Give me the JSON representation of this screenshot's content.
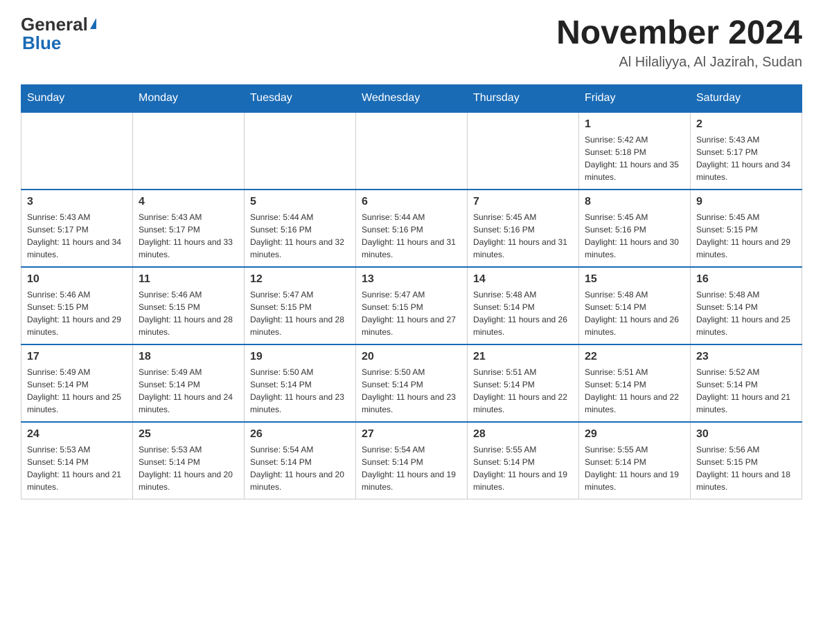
{
  "header": {
    "logo": {
      "general": "General",
      "blue": "Blue"
    },
    "title": "November 2024",
    "subtitle": "Al Hilaliyya, Al Jazirah, Sudan"
  },
  "weekdays": [
    "Sunday",
    "Monday",
    "Tuesday",
    "Wednesday",
    "Thursday",
    "Friday",
    "Saturday"
  ],
  "weeks": [
    [
      {
        "day": "",
        "info": ""
      },
      {
        "day": "",
        "info": ""
      },
      {
        "day": "",
        "info": ""
      },
      {
        "day": "",
        "info": ""
      },
      {
        "day": "",
        "info": ""
      },
      {
        "day": "1",
        "info": "Sunrise: 5:42 AM\nSunset: 5:18 PM\nDaylight: 11 hours and 35 minutes."
      },
      {
        "day": "2",
        "info": "Sunrise: 5:43 AM\nSunset: 5:17 PM\nDaylight: 11 hours and 34 minutes."
      }
    ],
    [
      {
        "day": "3",
        "info": "Sunrise: 5:43 AM\nSunset: 5:17 PM\nDaylight: 11 hours and 34 minutes."
      },
      {
        "day": "4",
        "info": "Sunrise: 5:43 AM\nSunset: 5:17 PM\nDaylight: 11 hours and 33 minutes."
      },
      {
        "day": "5",
        "info": "Sunrise: 5:44 AM\nSunset: 5:16 PM\nDaylight: 11 hours and 32 minutes."
      },
      {
        "day": "6",
        "info": "Sunrise: 5:44 AM\nSunset: 5:16 PM\nDaylight: 11 hours and 31 minutes."
      },
      {
        "day": "7",
        "info": "Sunrise: 5:45 AM\nSunset: 5:16 PM\nDaylight: 11 hours and 31 minutes."
      },
      {
        "day": "8",
        "info": "Sunrise: 5:45 AM\nSunset: 5:16 PM\nDaylight: 11 hours and 30 minutes."
      },
      {
        "day": "9",
        "info": "Sunrise: 5:45 AM\nSunset: 5:15 PM\nDaylight: 11 hours and 29 minutes."
      }
    ],
    [
      {
        "day": "10",
        "info": "Sunrise: 5:46 AM\nSunset: 5:15 PM\nDaylight: 11 hours and 29 minutes."
      },
      {
        "day": "11",
        "info": "Sunrise: 5:46 AM\nSunset: 5:15 PM\nDaylight: 11 hours and 28 minutes."
      },
      {
        "day": "12",
        "info": "Sunrise: 5:47 AM\nSunset: 5:15 PM\nDaylight: 11 hours and 28 minutes."
      },
      {
        "day": "13",
        "info": "Sunrise: 5:47 AM\nSunset: 5:15 PM\nDaylight: 11 hours and 27 minutes."
      },
      {
        "day": "14",
        "info": "Sunrise: 5:48 AM\nSunset: 5:14 PM\nDaylight: 11 hours and 26 minutes."
      },
      {
        "day": "15",
        "info": "Sunrise: 5:48 AM\nSunset: 5:14 PM\nDaylight: 11 hours and 26 minutes."
      },
      {
        "day": "16",
        "info": "Sunrise: 5:48 AM\nSunset: 5:14 PM\nDaylight: 11 hours and 25 minutes."
      }
    ],
    [
      {
        "day": "17",
        "info": "Sunrise: 5:49 AM\nSunset: 5:14 PM\nDaylight: 11 hours and 25 minutes."
      },
      {
        "day": "18",
        "info": "Sunrise: 5:49 AM\nSunset: 5:14 PM\nDaylight: 11 hours and 24 minutes."
      },
      {
        "day": "19",
        "info": "Sunrise: 5:50 AM\nSunset: 5:14 PM\nDaylight: 11 hours and 23 minutes."
      },
      {
        "day": "20",
        "info": "Sunrise: 5:50 AM\nSunset: 5:14 PM\nDaylight: 11 hours and 23 minutes."
      },
      {
        "day": "21",
        "info": "Sunrise: 5:51 AM\nSunset: 5:14 PM\nDaylight: 11 hours and 22 minutes."
      },
      {
        "day": "22",
        "info": "Sunrise: 5:51 AM\nSunset: 5:14 PM\nDaylight: 11 hours and 22 minutes."
      },
      {
        "day": "23",
        "info": "Sunrise: 5:52 AM\nSunset: 5:14 PM\nDaylight: 11 hours and 21 minutes."
      }
    ],
    [
      {
        "day": "24",
        "info": "Sunrise: 5:53 AM\nSunset: 5:14 PM\nDaylight: 11 hours and 21 minutes."
      },
      {
        "day": "25",
        "info": "Sunrise: 5:53 AM\nSunset: 5:14 PM\nDaylight: 11 hours and 20 minutes."
      },
      {
        "day": "26",
        "info": "Sunrise: 5:54 AM\nSunset: 5:14 PM\nDaylight: 11 hours and 20 minutes."
      },
      {
        "day": "27",
        "info": "Sunrise: 5:54 AM\nSunset: 5:14 PM\nDaylight: 11 hours and 19 minutes."
      },
      {
        "day": "28",
        "info": "Sunrise: 5:55 AM\nSunset: 5:14 PM\nDaylight: 11 hours and 19 minutes."
      },
      {
        "day": "29",
        "info": "Sunrise: 5:55 AM\nSunset: 5:14 PM\nDaylight: 11 hours and 19 minutes."
      },
      {
        "day": "30",
        "info": "Sunrise: 5:56 AM\nSunset: 5:15 PM\nDaylight: 11 hours and 18 minutes."
      }
    ]
  ]
}
